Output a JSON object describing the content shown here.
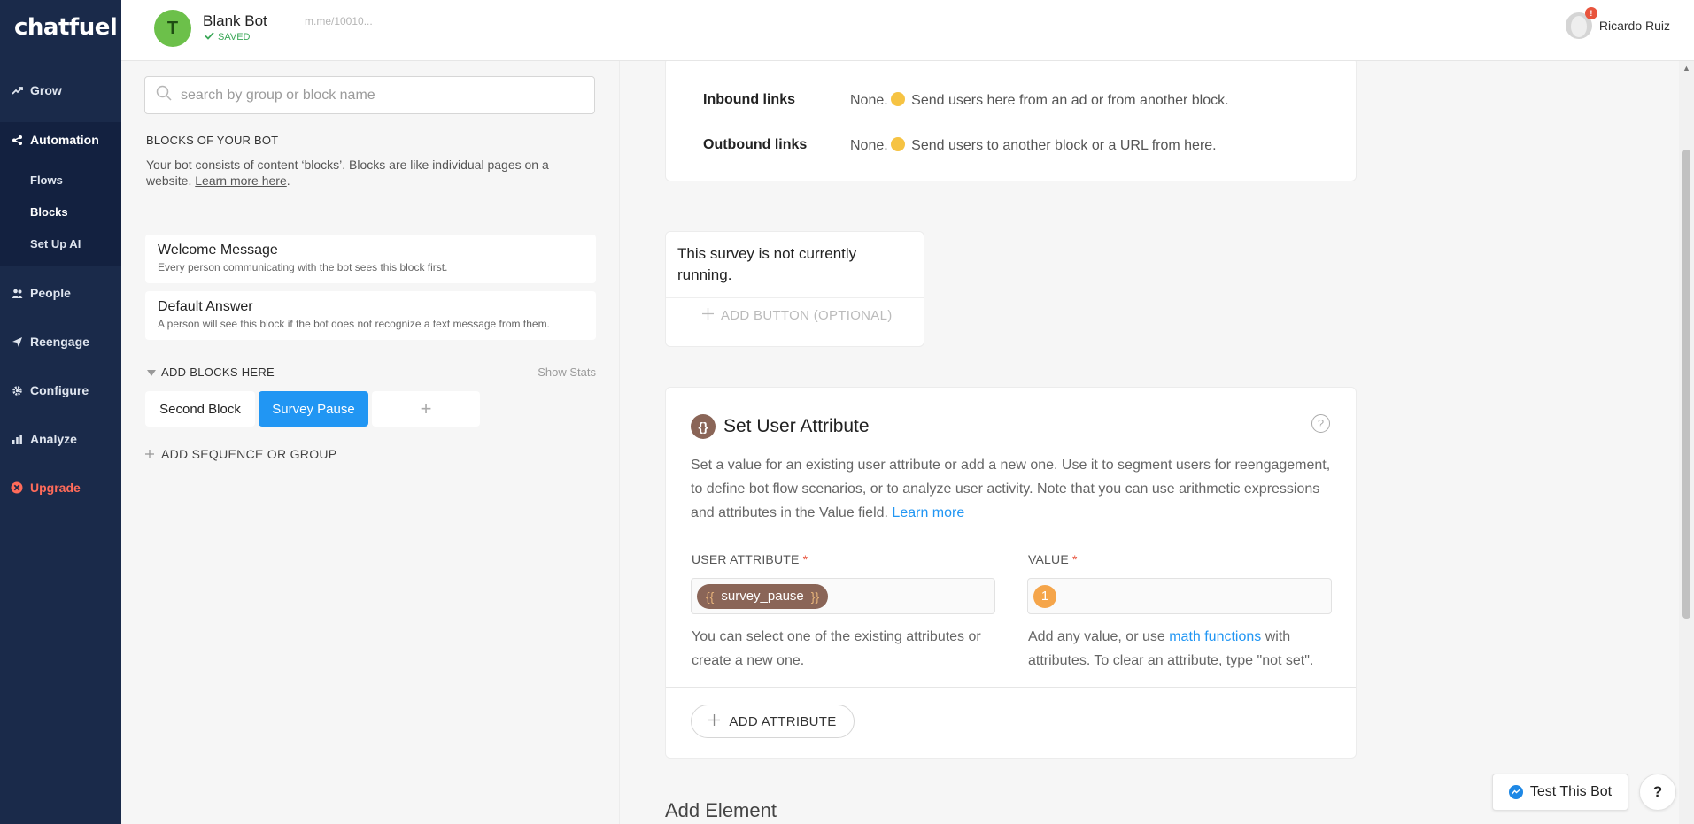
{
  "sidebar": {
    "logo": "chatfuel",
    "items": [
      {
        "label": "Grow",
        "icon": "trend-up-icon"
      },
      {
        "label": "Automation",
        "icon": "nodes-icon"
      },
      {
        "label": "People",
        "icon": "people-icon"
      },
      {
        "label": "Reengage",
        "icon": "paper-plane-icon"
      },
      {
        "label": "Configure",
        "icon": "gear-icon"
      },
      {
        "label": "Analyze",
        "icon": "bar-chart-icon"
      },
      {
        "label": "Upgrade",
        "icon": "upgrade-icon"
      }
    ],
    "sub_items": [
      "Flows",
      "Blocks",
      "Set Up AI"
    ]
  },
  "topbar": {
    "bot_initial": "T",
    "bot_name": "Blank Bot",
    "saved_label": "SAVED",
    "bot_link": "m.me/10010...",
    "user_name": "Ricardo Ruiz",
    "notification_badge": "!"
  },
  "left": {
    "search_placeholder": "search by group or block name",
    "section_title": "BLOCKS OF YOUR BOT",
    "section_desc": "Your bot consists of content ‘blocks’. Blocks are like individual pages on a website.",
    "learn_more": "Learn more here",
    "blocks": [
      {
        "title": "Welcome Message",
        "desc": "Every person communicating with the bot sees this block first."
      },
      {
        "title": "Default Answer",
        "desc": "A person will see this block if the bot does not recognize a text message from them."
      }
    ],
    "add_blocks_label": "ADD BLOCKS HERE",
    "show_stats": "Show Stats",
    "chips": [
      "Second Block",
      "Survey Pause",
      "+"
    ],
    "add_sequence": "ADD SEQUENCE OR GROUP"
  },
  "main": {
    "inbound_label": "Inbound links",
    "inbound_none": "None.",
    "inbound_text": "Send users here from an ad or from another block.",
    "outbound_label": "Outbound links",
    "outbound_none": "None.",
    "outbound_text": "Send users to another block or a URL from here.",
    "survey_text": "This survey is not currently running.",
    "add_button_optional": "ADD BUTTON (OPTIONAL)",
    "attr_title": "Set User Attribute",
    "attr_icon_glyph": "{}",
    "help_glyph": "?",
    "attr_desc": "Set a value for an existing user attribute or add a new one. Use it to segment users for reengagement, to define bot flow scenarios, or to analyze user activity. Note that you can use arithmetic expressions and attributes in the Value field.",
    "attr_learn_more": "Learn more",
    "user_attribute_label": "USER ATTRIBUTE",
    "value_label": "VALUE",
    "required_mark": "*",
    "attr_open_brace": "{{",
    "attr_name": "survey_pause",
    "attr_close_brace": "}}",
    "value": "1",
    "attr_help": "You can select one of the existing attributes or create a new one.",
    "value_help_pre": "Add any value, or use",
    "value_help_link": "math functions",
    "value_help_post": "with attributes. To clear an attribute, type \"not set\".",
    "add_attribute": "ADD ATTRIBUTE",
    "add_element": "Add Element"
  },
  "footer": {
    "test_bot": "Test This Bot",
    "help": "?"
  },
  "colors": {
    "sidebar_bg": "#1a2a4a",
    "accent_blue": "#2196f3",
    "attribute_brown": "#8a6557",
    "value_orange": "#f5a54a",
    "upgrade_red": "#ff6b5a",
    "saved_green": "#3aa757"
  }
}
